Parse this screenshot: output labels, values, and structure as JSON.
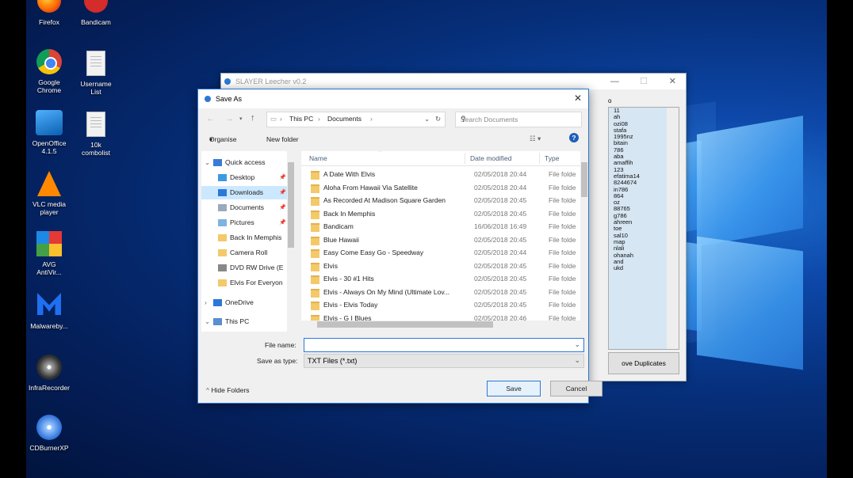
{
  "desktop": {
    "icons": [
      {
        "label": "Firefox",
        "icon": "firefox-icon"
      },
      {
        "label": "Bandicam",
        "icon": "bandicam-icon"
      },
      {
        "label": "Google Chrome",
        "icon": "chrome-icon"
      },
      {
        "label": "Username List",
        "icon": "text-file-icon"
      },
      {
        "label": "OpenOffice 4.1.5",
        "icon": "openoffice-icon"
      },
      {
        "label": "10k combolist",
        "icon": "text-file-icon"
      },
      {
        "label": "VLC media player",
        "icon": "vlc-icon"
      },
      {
        "label": "AVG AntiVir...",
        "icon": "avg-icon"
      },
      {
        "label": "Malwareby...",
        "icon": "malwarebytes-icon"
      },
      {
        "label": "InfraRecorder",
        "icon": "infrarecorder-icon"
      },
      {
        "label": "CDBurnerXP",
        "icon": "cdburnerxp-icon"
      }
    ]
  },
  "leecher": {
    "title": "SLAYER Leecher v0.2",
    "list_label": "o",
    "list": [
      "11",
      "ah",
      "ozi08",
      "stafa",
      "1995nz",
      "bitain",
      "786",
      "aba",
      "amaffih",
      "123",
      "efatima14",
      "8244674",
      "in786",
      "864",
      "oz",
      "88765",
      "g786",
      "ahreen",
      "toe",
      "sal10",
      "map",
      "nlali",
      "ohanah",
      "and",
      "ukd"
    ],
    "remove_duplicates": "ove Duplicates"
  },
  "dialog": {
    "title": "Save As",
    "breadcrumb": [
      "This PC",
      "Documents"
    ],
    "search_placeholder": "Search Documents",
    "organise": "Organise",
    "new_folder": "New folder",
    "nav": [
      {
        "label": "Quick access",
        "icon": "star-icon"
      },
      {
        "label": "Desktop",
        "icon": "desktop-icon"
      },
      {
        "label": "Downloads",
        "icon": "download-icon"
      },
      {
        "label": "Documents",
        "icon": "documents-icon"
      },
      {
        "label": "Pictures",
        "icon": "pictures-icon"
      },
      {
        "label": "Back In Memphis",
        "icon": "folder-icon"
      },
      {
        "label": "Camera Roll",
        "icon": "folder-icon"
      },
      {
        "label": "DVD RW Drive (E",
        "icon": "dvd-icon"
      },
      {
        "label": "Elvis For Everyon",
        "icon": "folder-icon"
      },
      {
        "label": "OneDrive",
        "icon": "cloud-icon"
      },
      {
        "label": "This PC",
        "icon": "pc-icon"
      }
    ],
    "columns": {
      "name": "Name",
      "date": "Date modified",
      "type": "Type"
    },
    "files": [
      {
        "name": "A Date With Elvis",
        "date": "02/05/2018 20:44",
        "type": "File folde"
      },
      {
        "name": "Aloha From Hawaii Via Satellite",
        "date": "02/05/2018 20:44",
        "type": "File folde"
      },
      {
        "name": "As Recorded At Madison Square Garden",
        "date": "02/05/2018 20:45",
        "type": "File folde"
      },
      {
        "name": "Back In Memphis",
        "date": "02/05/2018 20:45",
        "type": "File folde"
      },
      {
        "name": "Bandicam",
        "date": "16/06/2018 16:49",
        "type": "File folde"
      },
      {
        "name": "Blue Hawaii",
        "date": "02/05/2018 20:45",
        "type": "File folde"
      },
      {
        "name": "Easy Come Easy Go - Speedway",
        "date": "02/05/2018 20:44",
        "type": "File folde"
      },
      {
        "name": "Elvis",
        "date": "02/05/2018 20:45",
        "type": "File folde"
      },
      {
        "name": "Elvis - 30 #1 Hits",
        "date": "02/05/2018 20:45",
        "type": "File folde"
      },
      {
        "name": "Elvis - Always On My Mind (Ultimate Lov...",
        "date": "02/05/2018 20:45",
        "type": "File folde"
      },
      {
        "name": "Elvis - Elvis Today",
        "date": "02/05/2018 20:45",
        "type": "File folde"
      },
      {
        "name": "Elvis - G I Blues",
        "date": "02/05/2018 20:46",
        "type": "File folde"
      }
    ],
    "file_name_label": "File name:",
    "file_name_value": "",
    "save_type_label": "Save as type:",
    "save_type_value": "TXT Files (*.txt)",
    "hide_folders": "Hide Folders",
    "save": "Save",
    "cancel": "Cancel"
  }
}
